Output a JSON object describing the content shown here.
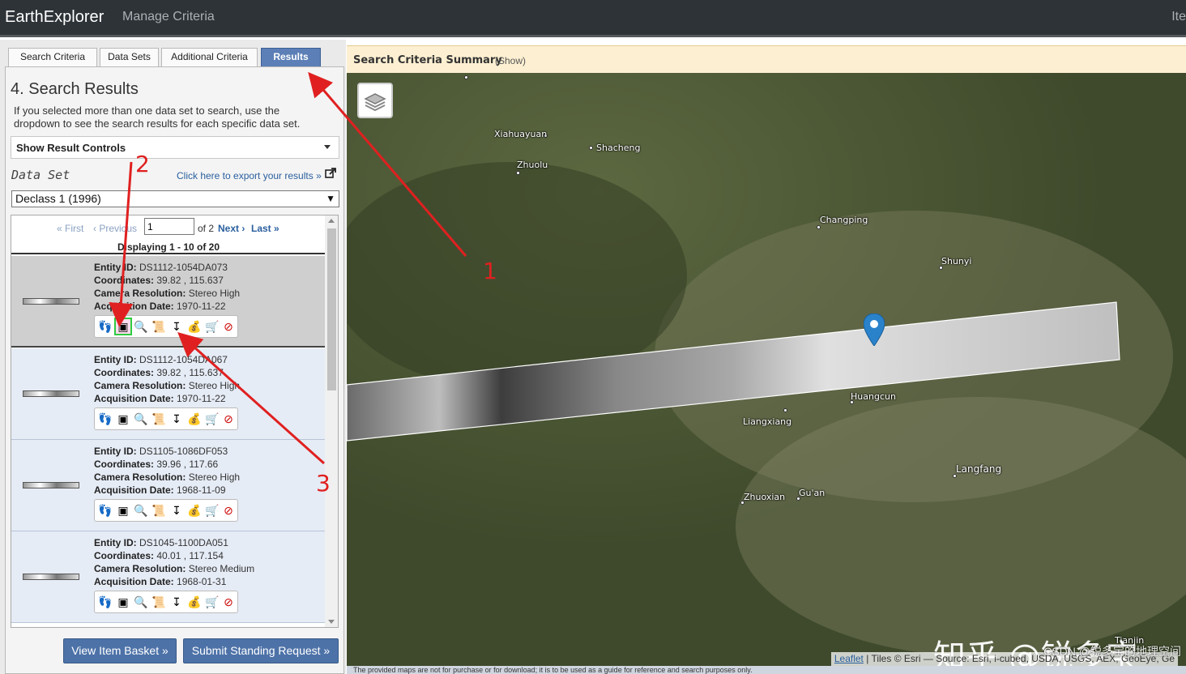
{
  "header": {
    "brand": "EarthExplorer",
    "manage": "Manage Criteria",
    "right_cut": "Ite"
  },
  "tabs": [
    {
      "label": "Search Criteria"
    },
    {
      "label": "Data Sets"
    },
    {
      "label": "Additional Criteria"
    },
    {
      "label": "Results"
    }
  ],
  "results_panel": {
    "title": "4. Search Results",
    "description": "If you selected more than one data set to search, use the dropdown to see the search results for each specific data set.",
    "controls_label": "Show Result Controls",
    "dataset_label": "Data Set",
    "export_link": "Click here to export your results »",
    "dataset_value": "Declass 1 (1996)"
  },
  "pager": {
    "first": "« First",
    "previous": "‹ Previous",
    "page_value": "1",
    "of_text": "of 2",
    "next": "Next ›",
    "last": "Last »",
    "displaying": "Displaying 1 - 10 of 20"
  },
  "records": [
    {
      "entity_label": "Entity ID:",
      "entity": "DS1112-1054DA073",
      "coords_label": "Coordinates:",
      "coords": "39.82 , 115.637",
      "cam_label": "Camera Resolution:",
      "cam": "Stereo High",
      "acq_label": "Acquisition Date:",
      "acq": "1970-11-22"
    },
    {
      "entity_label": "Entity ID:",
      "entity": "DS1112-1054DA067",
      "coords_label": "Coordinates:",
      "coords": "39.82 , 115.637",
      "cam_label": "Camera Resolution:",
      "cam": "Stereo High",
      "acq_label": "Acquisition Date:",
      "acq": "1970-11-22"
    },
    {
      "entity_label": "Entity ID:",
      "entity": "DS1105-1086DF053",
      "coords_label": "Coordinates:",
      "coords": "39.96 , 117.66",
      "cam_label": "Camera Resolution:",
      "cam": "Stereo High",
      "acq_label": "Acquisition Date:",
      "acq": "1968-11-09"
    },
    {
      "entity_label": "Entity ID:",
      "entity": "DS1045-1100DA051",
      "coords_label": "Coordinates:",
      "coords": "40.01 , 117.154",
      "cam_label": "Camera Resolution:",
      "cam": "Stereo Medium",
      "acq_label": "Acquisition Date:",
      "acq": "1968-01-31"
    }
  ],
  "buttons": {
    "basket": "View Item Basket »",
    "standing": "Submit Standing Request »"
  },
  "map": {
    "criteria_title": "Search Criteria Summary",
    "criteria_show": "(Show)",
    "cities": [
      "Xiahuayuan",
      "Shacheng",
      "Zhuolu",
      "Changping",
      "Shunyi",
      "Huangcun",
      "Liangxiang",
      "Langfang",
      "Zhuoxian",
      "Gu'an",
      "Tianjin"
    ],
    "attribution_link": "Leaflet",
    "attribution_text": "| Tiles © Esri — Source: Esri, i-cubed, USDA, USGS, AEX, GeoEye, Ge",
    "disclaimer": "The provided maps are not for purchase or for download; it is to be used as a guide for reference and search purposes only.",
    "watermark": "知乎 @锐多宝",
    "csdn": "CSDN @锐多宝的地理空间"
  },
  "annotations": [
    "1",
    "2",
    "3"
  ],
  "colors": {
    "accent": "#5b7fb6",
    "annotation": "#e02020",
    "header": "#2e3338"
  }
}
